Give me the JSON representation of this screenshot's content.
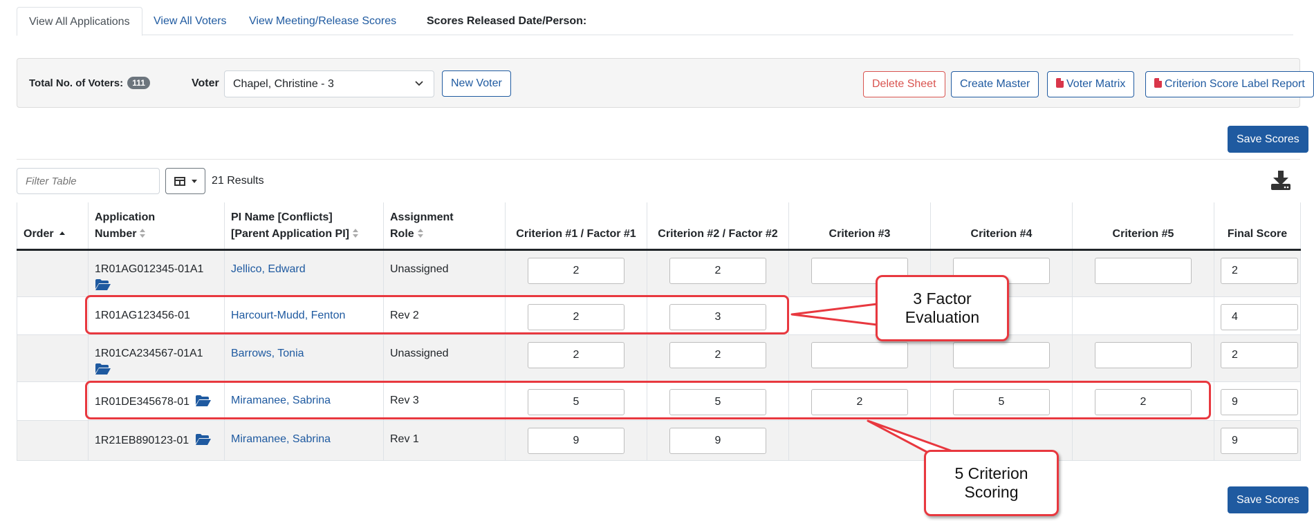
{
  "tabs": [
    {
      "label": "View All Applications",
      "active": true
    },
    {
      "label": "View All Voters",
      "active": false
    },
    {
      "label": "View Meeting/Release Scores",
      "active": false
    }
  ],
  "tab_info": "Scores Released Date/Person:",
  "toolbar": {
    "voters_label": "Total No. of Voters:",
    "voters_count": "111",
    "voter_label": "Voter",
    "voter_value": "Chapel, Christine - 3",
    "new_voter": "New Voter",
    "delete_sheet": "Delete Sheet",
    "create_master": "Create Master",
    "voter_matrix": "Voter Matrix",
    "criterion_report": "Criterion Score Label Report"
  },
  "save_scores": "Save Scores",
  "filter": {
    "placeholder": "Filter Table"
  },
  "results": "21 Results",
  "columns": {
    "order": "Order",
    "app_line1": "Application",
    "app_line2": "Number",
    "pi_line1": "PI Name [Conflicts]",
    "pi_line2": "[Parent Application PI]",
    "role_line1": "Assignment",
    "role_line2": "Role",
    "c1": "Criterion #1 / Factor #1",
    "c2": "Criterion #2 / Factor #2",
    "c3": "Criterion #3",
    "c4": "Criterion #4",
    "c5": "Criterion #5",
    "final": "Final Score"
  },
  "rows": [
    {
      "app": "1R01AG012345-01A1",
      "pi": "Jellico, Edward",
      "role": "Unassigned",
      "c1": "2",
      "c2": "2",
      "c3": "",
      "c4": "",
      "c5": "",
      "final": "2"
    },
    {
      "app": "1R01AG123456-01",
      "pi": "Harcourt-Mudd, Fenton",
      "role": "Rev 2",
      "c1": "2",
      "c2": "3",
      "final": "4"
    },
    {
      "app": "1R01CA234567-01A1",
      "pi": "Barrows, Tonia",
      "role": "Unassigned",
      "c1": "2",
      "c2": "2",
      "c3": "",
      "c4": "",
      "c5": "",
      "final": "2"
    },
    {
      "app": "1R01DE345678-01",
      "pi": "Miramanee, Sabrina",
      "role": "Rev 3",
      "c1": "5",
      "c2": "5",
      "c3": "2",
      "c4": "5",
      "c5": "2",
      "final": "9"
    },
    {
      "app": "1R21EB890123-01",
      "pi": "Miramanee, Sabrina",
      "role": "Rev 1",
      "c1": "9",
      "c2": "9",
      "final": "9"
    }
  ],
  "callouts": {
    "factor": "3 Factor\nEvaluation",
    "criterion": "5 Criterion\nScoring"
  },
  "colors": {
    "accent": "#1f5aa0",
    "danger": "#d9534f",
    "highlight": "#e8383f"
  },
  "icons": [
    "folder-open-icon",
    "download-icon",
    "pdf-icon",
    "table-columns-icon",
    "sort-icon",
    "chevron-down-icon"
  ]
}
